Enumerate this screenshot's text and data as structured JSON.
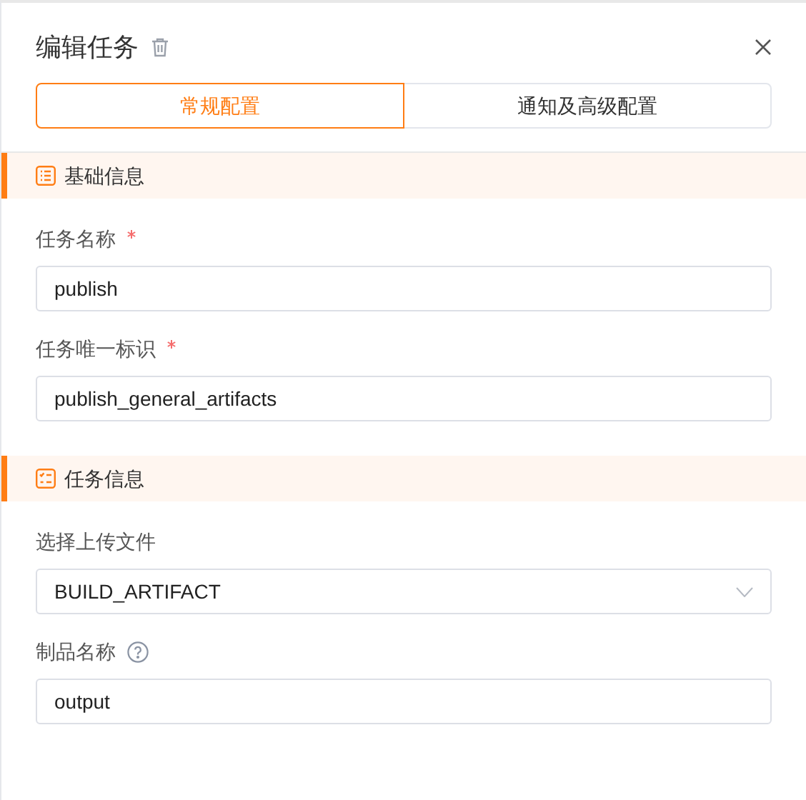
{
  "title": "编辑任务",
  "tabs": [
    {
      "label": "常规配置",
      "selected": true
    },
    {
      "label": "通知及高级配置",
      "selected": false
    }
  ],
  "sections": [
    {
      "title": "基础信息",
      "kind": "list",
      "fields": [
        {
          "kind": "input",
          "label": "任务名称",
          "required": true,
          "help": false,
          "value": "publish"
        },
        {
          "kind": "input",
          "label": "任务唯一标识",
          "required": true,
          "help": false,
          "value": "publish_general_artifacts"
        }
      ]
    },
    {
      "title": "任务信息",
      "kind": "checklist",
      "fields": [
        {
          "kind": "select",
          "label": "选择上传文件",
          "required": false,
          "help": false,
          "value": "BUILD_ARTIFACT"
        },
        {
          "kind": "input",
          "label": "制品名称",
          "required": false,
          "help": true,
          "value": "output"
        }
      ]
    }
  ]
}
